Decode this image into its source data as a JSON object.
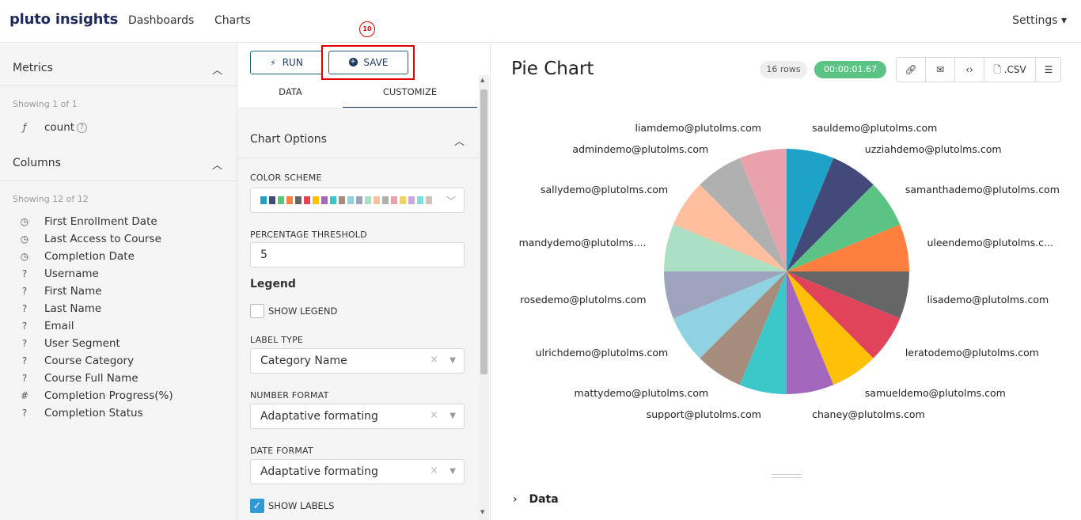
{
  "topbar": {
    "logo": "pluto insights",
    "nav": [
      "Dashboards",
      "Charts"
    ],
    "settings": "Settings ▾"
  },
  "left": {
    "metrics_title": "Metrics",
    "metrics_showing": "Showing 1 of 1",
    "metric": {
      "icon": "function-icon",
      "icon_glyph": "ƒ",
      "label": "count"
    },
    "columns_title": "Columns",
    "columns_showing": "Showing 12 of 12",
    "columns": [
      {
        "icon": "clock-icon",
        "glyph": "◷",
        "label": "First Enrollment Date"
      },
      {
        "icon": "clock-icon",
        "glyph": "◷",
        "label": "Last Access to Course"
      },
      {
        "icon": "clock-icon",
        "glyph": "◷",
        "label": "Completion Date"
      },
      {
        "icon": "text-icon",
        "glyph": "?",
        "label": "Username"
      },
      {
        "icon": "text-icon",
        "glyph": "?",
        "label": "First Name"
      },
      {
        "icon": "text-icon",
        "glyph": "?",
        "label": "Last Name"
      },
      {
        "icon": "text-icon",
        "glyph": "?",
        "label": "Email"
      },
      {
        "icon": "text-icon",
        "glyph": "?",
        "label": "User Segment"
      },
      {
        "icon": "text-icon",
        "glyph": "?",
        "label": "Course Category"
      },
      {
        "icon": "text-icon",
        "glyph": "?",
        "label": "Course Full Name"
      },
      {
        "icon": "number-icon",
        "glyph": "#",
        "label": "Completion Progress(%)"
      },
      {
        "icon": "text-icon",
        "glyph": "?",
        "label": "Completion Status"
      }
    ]
  },
  "middle": {
    "run_label": "RUN",
    "save_label": "SAVE",
    "annotation_number": "10",
    "tabs": [
      "DATA",
      "CUSTOMIZE"
    ],
    "chart_options": "Chart Options",
    "color_scheme_label": "COLOR SCHEME",
    "color_scheme": [
      "#1fa2c8",
      "#434a7a",
      "#5bc485",
      "#ff7f3f",
      "#666666",
      "#e0435a",
      "#ffc107",
      "#a367bd",
      "#3cc8c8",
      "#a58c7c",
      "#8fd3e3",
      "#9ea4bd",
      "#abe0c4",
      "#ffbf9e",
      "#b0b0b0",
      "#e9a3ab",
      "#f4d35e",
      "#c8a8dd",
      "#7fdede",
      "#cfc2b8"
    ],
    "percentage_threshold_label": "PERCENTAGE THRESHOLD",
    "percentage_threshold": "5",
    "legend_heading": "Legend",
    "show_legend_label": "SHOW LEGEND",
    "show_legend": false,
    "label_type_label": "LABEL TYPE",
    "label_type": "Category Name",
    "number_format_label": "NUMBER FORMAT",
    "number_format": "Adaptative formating",
    "date_format_label": "DATE FORMAT",
    "date_format": "Adaptative formating",
    "show_labels_label": "SHOW LABELS",
    "show_labels": true
  },
  "right": {
    "title": "Pie Chart",
    "rows": "16 rows",
    "time": "00:00:01.67",
    "csv_label": ".CSV",
    "data_label": "Data"
  },
  "chart_data": {
    "type": "pie",
    "categories": [
      "sauldemo@plutolms.com",
      "uzziahdemo@plutolms.com",
      "samanthademo@plutolms.com",
      "uleendemo@plutolms.c...",
      "lisademo@plutolms.com",
      "leratodemo@plutolms.com",
      "samueldemo@plutolms.com",
      "chaney@plutolms.com",
      "support@plutolms.com",
      "mattydemo@plutolms.com",
      "ulrichdemo@plutolms.com",
      "rosedemo@plutolms.com",
      "mandydemo@plutolms....",
      "sallydemo@plutolms.com",
      "admindemo@plutolms.com",
      "liamdemo@plutolms.com"
    ],
    "values": [
      1,
      1,
      1,
      1,
      1,
      1,
      1,
      1,
      1,
      1,
      1,
      1,
      1,
      1,
      1,
      1
    ],
    "colors": [
      "#1fa2c8",
      "#434a7a",
      "#5bc485",
      "#ff7f3f",
      "#666666",
      "#e0435a",
      "#ffc107",
      "#a367bd",
      "#3cc8c8",
      "#a58c7c",
      "#8fd3e3",
      "#9ea4bd",
      "#abe0c4",
      "#ffbf9e",
      "#b0b0b0",
      "#e9a3ab"
    ],
    "legend": false,
    "labels_shown": true
  }
}
